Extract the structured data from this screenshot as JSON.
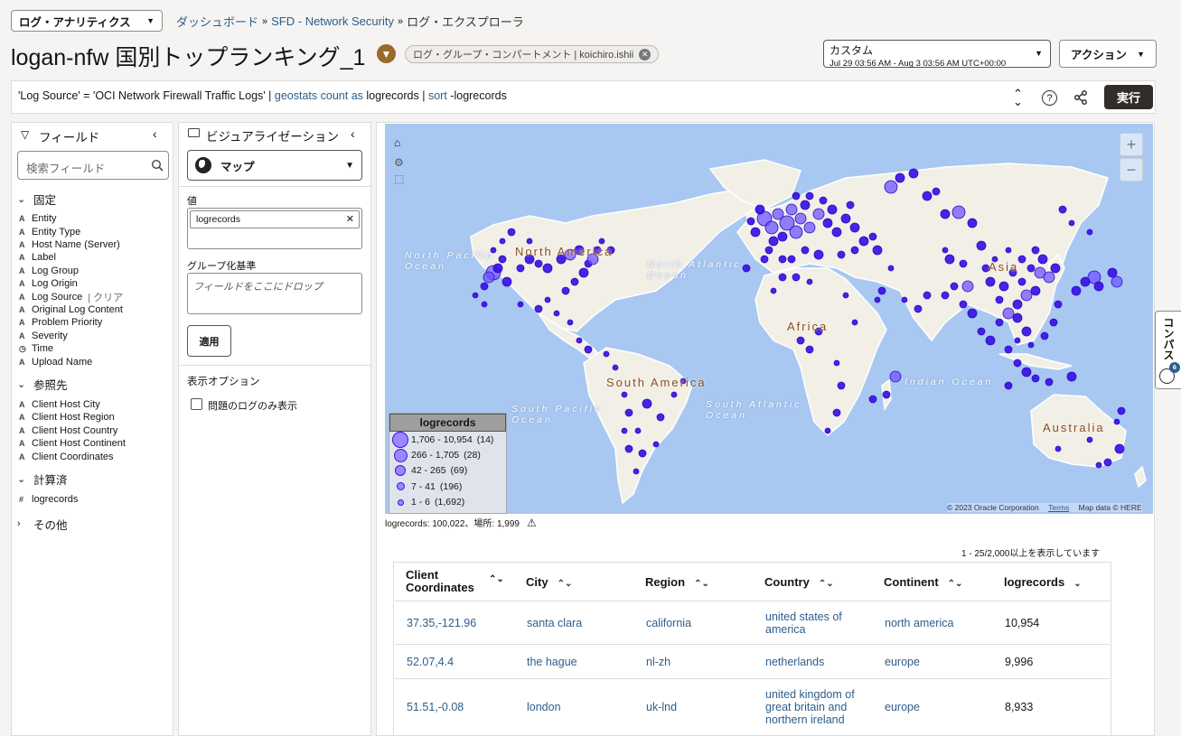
{
  "header": {
    "app_selector": "ログ・アナリティクス",
    "breadcrumbs": [
      "ダッシュボード",
      "SFD - Network Security",
      "ログ・エクスプローラ"
    ],
    "title": "logan-nfw 国別トップランキング_1",
    "compartment_badge": "ログ・グループ・コンパートメント | koichiro.ishii",
    "time_range_label": "カスタム",
    "time_range_value": "Jul 29 03:56 AM - Aug 3 03:56 AM UTC+00:00",
    "actions_label": "アクション"
  },
  "query": {
    "p1": "'Log Source' = 'OCI Network Firewall Traffic Logs' |",
    "kw1": "geostats",
    "kw2": "count",
    "kw3": "as",
    "p2": "logrecords |",
    "kw4": "sort",
    "p3": "-logrecords",
    "run_label": "実行"
  },
  "fields_panel": {
    "title": "フィールド",
    "search_placeholder": "検索フィールド",
    "sections": [
      {
        "label": "固定",
        "items": [
          {
            "type": "A",
            "name": "Entity"
          },
          {
            "type": "A",
            "name": "Entity Type"
          },
          {
            "type": "A",
            "name": "Host Name (Server)"
          },
          {
            "type": "A",
            "name": "Label"
          },
          {
            "type": "A",
            "name": "Log Group"
          },
          {
            "type": "A",
            "name": "Log Origin"
          },
          {
            "type": "A",
            "name": "Log Source",
            "extra": "| クリア"
          },
          {
            "type": "A",
            "name": "Original Log Content"
          },
          {
            "type": "A",
            "name": "Problem Priority"
          },
          {
            "type": "A",
            "name": "Severity"
          },
          {
            "type": "◷",
            "name": "Time"
          },
          {
            "type": "A",
            "name": "Upload Name"
          }
        ]
      },
      {
        "label": "参照先",
        "items": [
          {
            "type": "A",
            "name": "Client Host City"
          },
          {
            "type": "A",
            "name": "Client Host Region"
          },
          {
            "type": "A",
            "name": "Client Host Country"
          },
          {
            "type": "A",
            "name": "Client Host Continent"
          },
          {
            "type": "A",
            "name": "Client Coordinates"
          }
        ]
      },
      {
        "label": "計算済",
        "items": [
          {
            "type": "#",
            "name": "logrecords"
          }
        ]
      }
    ],
    "other_label": "その他"
  },
  "viz_panel": {
    "title": "ビジュアライゼーション",
    "viz_type": "マップ",
    "value_label": "値",
    "value_chip": "logrecords",
    "groupby_label": "グループ化基準",
    "groupby_placeholder": "フィールドをここにドロップ",
    "apply_label": "適用",
    "display_options_label": "表示オプション",
    "problem_logs_label": "問題のログのみ表示"
  },
  "map": {
    "labels": {
      "north_america": "North America",
      "north_pacific": "North Pacific Ocean",
      "north_atlantic": "North Atlantic Ocean",
      "africa": "Africa",
      "asia": "Asia",
      "south_america": "South America",
      "south_pacific": "South Pacific Ocean",
      "south_atlantic": "South Atlantic Ocean",
      "indian": "Indian Ocean",
      "australia": "Australia"
    },
    "legend_title": "logrecords",
    "legend": [
      {
        "range": "1,706 - 10,954",
        "count": "(14)"
      },
      {
        "range": "266 - 1,705",
        "count": "(28)"
      },
      {
        "range": "42 - 265",
        "count": "(69)"
      },
      {
        "range": "7 - 41",
        "count": "(196)"
      },
      {
        "range": "1 - 6",
        "count": "(1,692)"
      }
    ],
    "attribution": "© 2023 Oracle Corporation",
    "terms": "Terms",
    "mapdata": "Map data © HERE",
    "summary": "logrecords: 100,022、場所: 1,999",
    "zoom_in": "+",
    "zoom_out": "−",
    "marker_color": "#3a10e5"
  },
  "table": {
    "range_text": "1 - 25/2,000以上を表示しています",
    "columns": [
      "Client Coordinates",
      "City",
      "Region",
      "Country",
      "Continent",
      "logrecords"
    ],
    "rows": [
      {
        "coords": "37.35,-121.96",
        "city": "santa clara",
        "region": "california",
        "country": "united states of america",
        "continent": "north america",
        "count": "10,954"
      },
      {
        "coords": "52.07,4.4",
        "city": "the hague",
        "region": "nl-zh",
        "country": "netherlands",
        "continent": "europe",
        "count": "9,996"
      },
      {
        "coords": "51.51,-0.08",
        "city": "london",
        "region": "uk-lnd",
        "country": "united kingdom of great britain and northern ireland",
        "continent": "europe",
        "count": "8,933"
      }
    ]
  },
  "compass": {
    "label": "コンパス",
    "badge": "6"
  }
}
